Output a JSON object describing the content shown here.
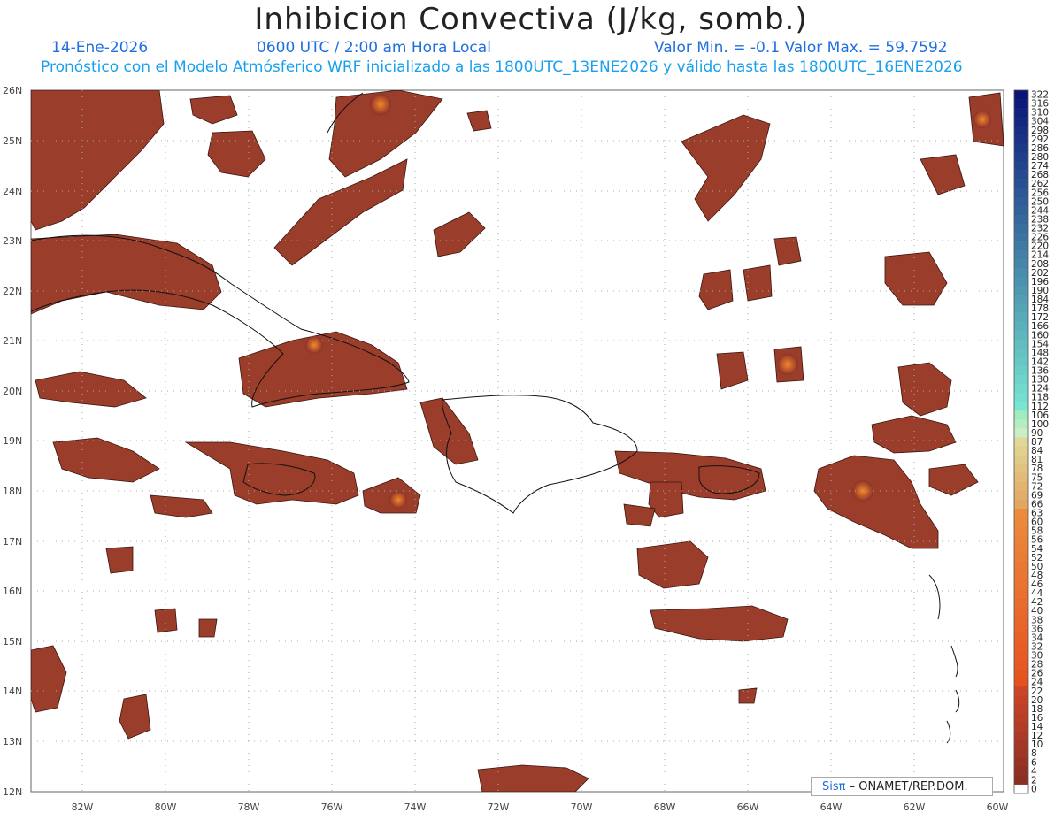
{
  "header": {
    "title": "Inhibicion Convectiva (J/kg, somb.)",
    "date": "14-Ene-2026",
    "time": "0600 UTC / 2:00 am Hora Local",
    "minmax": "Valor Min. = -0.1  Valor Max. = 59.7592",
    "forecast": "Pronóstico con el Modelo Atmósferico WRF inicializado a las 1800UTC_13ENE2026 y válido hasta las  1800UTC_16ENE2026"
  },
  "axes": {
    "lat_labels": [
      "26N",
      "25N",
      "24N",
      "23N",
      "22N",
      "21N",
      "20N",
      "19N",
      "18N",
      "17N",
      "16N",
      "15N",
      "14N",
      "13N",
      "12N"
    ],
    "lon_labels": [
      "82W",
      "80W",
      "78W",
      "76W",
      "74W",
      "72W",
      "70W",
      "68W",
      "66W",
      "64W",
      "62W",
      "60W"
    ]
  },
  "colorbar": {
    "labels": [
      "322",
      "316",
      "310",
      "304",
      "298",
      "292",
      "286",
      "280",
      "274",
      "268",
      "262",
      "256",
      "250",
      "244",
      "238",
      "232",
      "226",
      "220",
      "214",
      "208",
      "202",
      "196",
      "190",
      "184",
      "178",
      "172",
      "166",
      "160",
      "154",
      "148",
      "142",
      "136",
      "130",
      "124",
      "118",
      "112",
      "106",
      "100",
      "90",
      "87",
      "84",
      "81",
      "78",
      "75",
      "72",
      "69",
      "66",
      "63",
      "60",
      "58",
      "56",
      "54",
      "52",
      "50",
      "48",
      "46",
      "44",
      "42",
      "40",
      "38",
      "36",
      "34",
      "32",
      "30",
      "28",
      "26",
      "24",
      "22",
      "20",
      "18",
      "16",
      "14",
      "12",
      "10",
      "8",
      "6",
      "4",
      "2",
      "0"
    ]
  },
  "colors": {
    "field_dark": "#8b3328",
    "field_mid": "#a5452c",
    "field_hot": "#e2702c",
    "title_blue": "#1f6fe0"
  },
  "credit": {
    "logo": "Sisπ",
    "text": "– ONAMET/REP.DOM."
  }
}
